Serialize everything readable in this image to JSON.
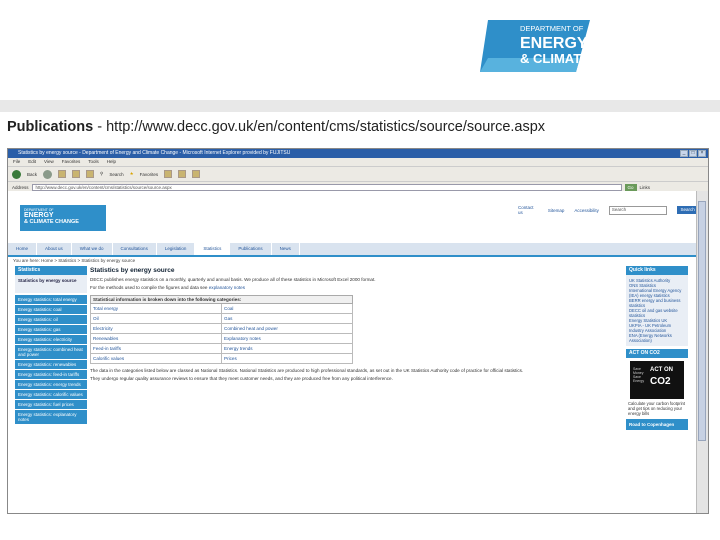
{
  "slide": {
    "logo": {
      "line1": "DEPARTMENT OF",
      "line2": "ENERGY",
      "line3": "& CLIMATE CHANGE"
    },
    "title_label": "Publications",
    "title_sep": " - ",
    "title_url": "http://www.decc.gov.uk/en/content/cms/statistics/source/source.aspx"
  },
  "browser": {
    "window_title": "Statistics by energy source - Department of Energy and Climate Change - Microsoft Internet Explorer provided by FUJITSU",
    "menu": [
      "File",
      "Edit",
      "View",
      "Favorites",
      "Tools",
      "Help"
    ],
    "toolbar": {
      "back": "Back",
      "search": "Search",
      "favorites": "Favorites"
    },
    "address_label": "Address",
    "address": "http://www.decc.gov.uk/en/content/cms/statistics/source/source.aspx",
    "go": "Go",
    "links": "Links"
  },
  "site": {
    "logo": {
      "line1": "DEPARTMENT OF",
      "line2": "ENERGY",
      "line3": "& CLIMATE CHANGE"
    },
    "toplinks": [
      "Contact us",
      "Sitemap",
      "Accessibility"
    ],
    "search_placeholder": "Search",
    "search_button": "Search",
    "nav": [
      "Home",
      "About us",
      "What we do",
      "Consultations",
      "Legislation",
      "Statistics",
      "Publications",
      "News"
    ],
    "breadcrumb": "You are here: Home > Statistics > Statistics by energy source"
  },
  "sidebar": {
    "heading": "Statistics",
    "current": "Statistics by energy source",
    "items": [
      "Energy statistics: total energy",
      "Energy statistics: coal",
      "Energy statistics: oil",
      "Energy statistics: gas",
      "Energy statistics: electricity",
      "Energy statistics: combined heat and power",
      "Energy statistics: renewables",
      "Energy statistics: feed-in tariffs",
      "Energy statistics: energy trends",
      "Energy statistics: calorific values",
      "Energy statistics: fuel prices",
      "Energy statistics: explanatory notes"
    ]
  },
  "content": {
    "title": "Statistics by energy source",
    "intro": "DECC publishes energy statistics on a monthly, quarterly and annual basis. We produce all of these statistics in Microsoft Excel 2000 format.",
    "method_prefix": "For the methods used to compile the figures and data see",
    "method_link": "explanatory notes",
    "table_header": "Statistical information is broken down into the following categories:",
    "table_rows": [
      [
        "Total energy",
        "Coal"
      ],
      [
        "Oil",
        "Gas"
      ],
      [
        "Electricity",
        "Combined heat and power"
      ],
      [
        "Renewables",
        "Explanatory notes"
      ],
      [
        "Feed-in tariffs",
        "Energy trends"
      ],
      [
        "Calorific values",
        "Prices"
      ]
    ],
    "note1": "The data in the categories listed below are classed as National Statistics. National Statistics are produced to high professional standards, as set out in the UK Statistics Authority code of practice for official statistics.",
    "note2": "They undergo regular quality assurance reviews to ensure that they meet customer needs, and they are produced free from any political interference."
  },
  "right": {
    "heading": "Quick links",
    "links": [
      "UK Statistics Authority",
      "ONS Statistics",
      "International Energy Agency (IEA) energy statistics",
      "BERR energy and business statistics",
      "DECC oil and gas website statistics",
      "Energy Statistics UK",
      "UKPIA - UK Petroleum Industry Association",
      "ENA (Energy Networks Association)"
    ],
    "act_heading": "ACT ON CO2",
    "act_small1": "Save Money Save Energy",
    "act_text1": "ACT ON",
    "act_text2": "CO2",
    "act_caption": "Calculate your carbon footprint and get tips on reducing your energy bills",
    "cop": "Road to Copenhagen"
  }
}
